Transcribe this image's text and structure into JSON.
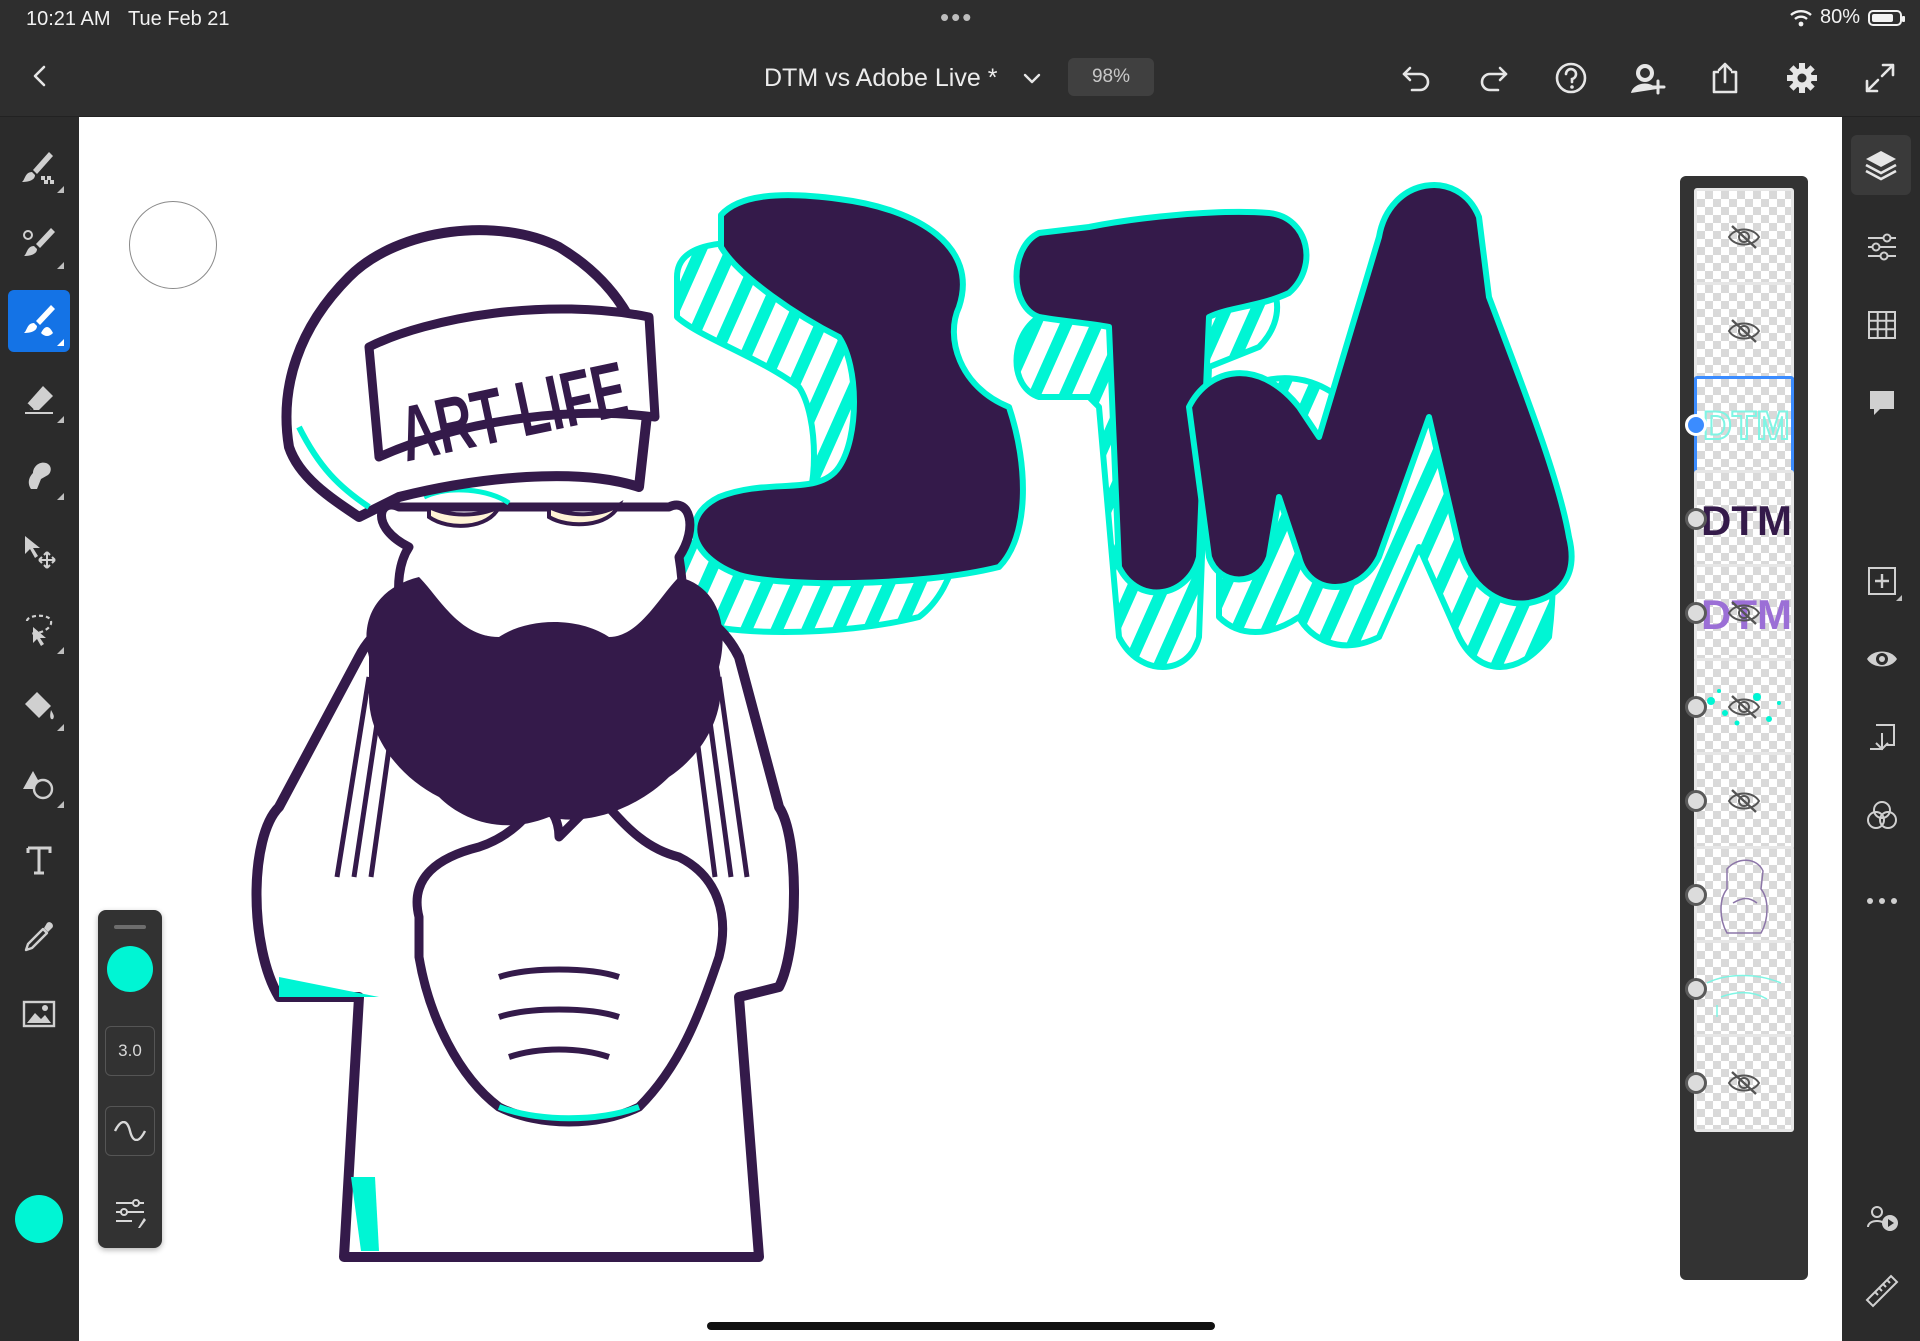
{
  "status_bar": {
    "time": "10:21 AM",
    "date": "Tue Feb 21",
    "battery_text": "80%",
    "battery_level": 0.8
  },
  "top_bar": {
    "document_title": "DTM vs Adobe Live *",
    "zoom": "98%",
    "icons": [
      "back-chevron-icon",
      "title-dropdown-chevron-icon",
      "undo-icon",
      "redo-icon",
      "help-icon",
      "invite-user-icon",
      "share-icon",
      "settings-gear-icon",
      "fullscreen-icon"
    ]
  },
  "left_toolbar": {
    "tools": [
      "pixel-brush",
      "vector-brush",
      "live-brush",
      "eraser",
      "smudge",
      "transform",
      "selection",
      "fill",
      "shapes",
      "text",
      "eyedropper",
      "image"
    ],
    "active_tool": "live-brush",
    "current_color": "#00f5d4"
  },
  "brush_settings": {
    "color": "#00f5d4",
    "size": "3.0"
  },
  "canvas": {
    "cap_text": "ART LIFE",
    "logo_text": "DTM",
    "colors": {
      "ink": "#341a4a",
      "accent": "#00f5d4",
      "paper": "#ffffff"
    }
  },
  "layers": {
    "selected_index": 2,
    "items": [
      {
        "thumbnail": "empty",
        "hidden": true
      },
      {
        "thumbnail": "empty",
        "hidden": true
      },
      {
        "thumbnail": "dtm-outline-teal",
        "hidden": false
      },
      {
        "thumbnail": "dtm-dark",
        "hidden": false
      },
      {
        "thumbnail": "dtm-purple",
        "hidden": true
      },
      {
        "thumbnail": "teal-splatter",
        "hidden": true
      },
      {
        "thumbnail": "empty",
        "hidden": true
      },
      {
        "thumbnail": "character-sketch",
        "hidden": false
      },
      {
        "thumbnail": "teal-sketch",
        "hidden": false
      },
      {
        "thumbnail": "empty",
        "hidden": true
      }
    ]
  },
  "right_toolbar": {
    "icons": [
      "layers-icon",
      "layer-properties-icon",
      "grid-icon",
      "comments-icon",
      "add-layer-icon",
      "visibility-icon",
      "merge-down-icon",
      "blend-mode-icon",
      "more-icon",
      "livestream-icon",
      "ruler-icon"
    ],
    "active": "layers-icon"
  }
}
